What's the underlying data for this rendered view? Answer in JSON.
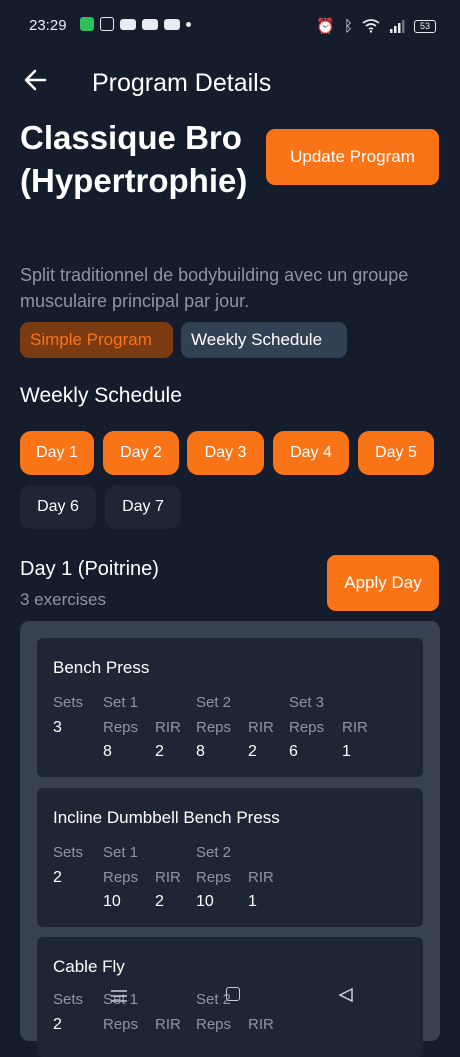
{
  "status_bar": {
    "time": "23:29",
    "battery": "53"
  },
  "header": {
    "title": "Program Details"
  },
  "program": {
    "name": "Classique Bro (Hypertrophie)",
    "description": "Split traditionnel de bodybuilding avec un groupe musculaire principal par jour.",
    "update_label": "Update Program",
    "tags": [
      "Simple Program",
      "Weekly Schedule"
    ]
  },
  "schedule": {
    "title": "Weekly Schedule",
    "days": [
      "Day 1",
      "Day 2",
      "Day 3",
      "Day 4",
      "Day 5",
      "Day 6",
      "Day 7"
    ],
    "active_days": [
      "Day 1",
      "Day 2",
      "Day 3",
      "Day 4",
      "Day 5"
    ]
  },
  "selected_day": {
    "title": "Day 1 (Poitrine)",
    "count": "3 exercises",
    "apply_label": "Apply Day"
  },
  "labels": {
    "sets": "Sets",
    "reps": "Reps",
    "rir": "RIR"
  },
  "exercises": [
    {
      "name": "Bench Press",
      "sets": "3",
      "set_list": [
        {
          "label": "Set 1",
          "reps": "8",
          "rir": "2"
        },
        {
          "label": "Set 2",
          "reps": "8",
          "rir": "2"
        },
        {
          "label": "Set 3",
          "reps": "6",
          "rir": "1"
        }
      ]
    },
    {
      "name": "Incline Dumbbell Bench Press",
      "sets": "2",
      "set_list": [
        {
          "label": "Set 1",
          "reps": "10",
          "rir": "2"
        },
        {
          "label": "Set 2",
          "reps": "10",
          "rir": "1"
        }
      ]
    },
    {
      "name": "Cable Fly",
      "sets": "2",
      "set_list": [
        {
          "label": "Set 1"
        },
        {
          "label": "Set 2"
        }
      ]
    }
  ],
  "colors": {
    "accent": "#f97317",
    "background": "#151c2b",
    "card": "#1e2535",
    "panel": "#374151",
    "tag_simple_bg": "#7b3b12",
    "muted_text": "#8d95a3"
  },
  "icons": {
    "back": "arrow-left-icon",
    "nav_menu": "menu-icon",
    "nav_home": "home-icon",
    "nav_back": "triangle-back-icon"
  }
}
